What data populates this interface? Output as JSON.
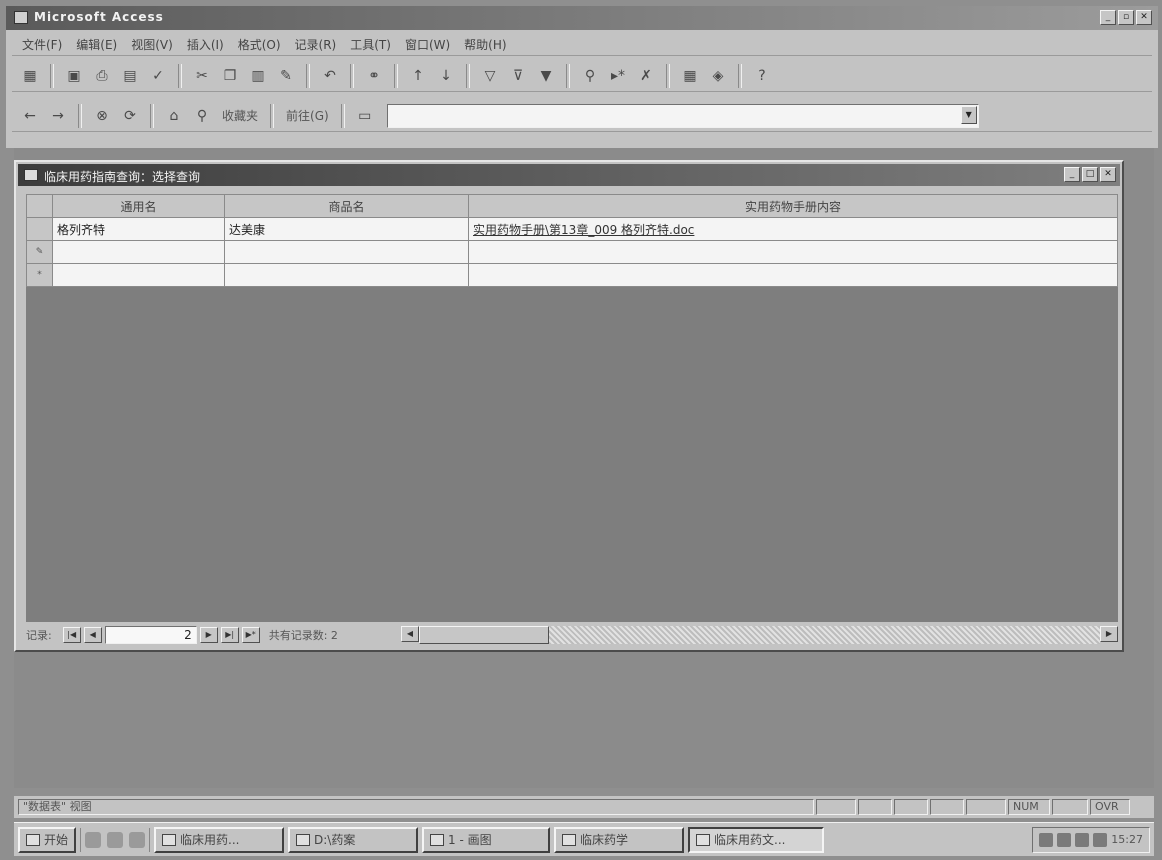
{
  "app": {
    "title": "Microsoft Access",
    "caption_buttons": [
      "minimize",
      "restore",
      "close"
    ]
  },
  "menubar": {
    "items": [
      "文件(F)",
      "编辑(E)",
      "视图(V)",
      "插入(I)",
      "格式(O)",
      "记录(R)",
      "工具(T)",
      "窗口(W)",
      "帮助(H)"
    ]
  },
  "toolbar1": {
    "icons": [
      "view-icon",
      "save-icon",
      "print-icon",
      "print-preview-icon",
      "spelling-icon",
      "cut-icon",
      "copy-icon",
      "paste-icon",
      "format-painter-icon",
      "undo-icon",
      "insert-hyperlink-icon",
      "sort-ascending-icon",
      "sort-descending-icon",
      "filter-by-selection-icon",
      "filter-by-form-icon",
      "apply-filter-icon",
      "find-icon",
      "new-record-icon",
      "delete-record-icon",
      "database-window-icon",
      "new-object-icon",
      "help-icon"
    ]
  },
  "toolbar2": {
    "favorites_label": "收藏夹",
    "go_label": "前往(G)",
    "address_value": ""
  },
  "query_window": {
    "title": "临床用药指南查询：选择查询",
    "columns": [
      "通用名",
      "商品名",
      "实用药物手册内容"
    ],
    "rows": [
      {
        "selector": "",
        "generic": "格列齐特",
        "brand": "达美康",
        "content": "实用药物手册\\第13章_009 格列齐特.doc"
      },
      {
        "selector": "✎",
        "generic": "",
        "brand": "",
        "content": ""
      },
      {
        "selector": "*",
        "generic": "",
        "brand": "",
        "content": ""
      }
    ],
    "nav": {
      "record_label": "记录:",
      "current_record": "2",
      "total_text": "共有记录数: 2"
    }
  },
  "statusbar": {
    "text": "\"数据表\" 视图",
    "indicators": [
      "",
      "",
      "",
      "",
      "",
      "NUM",
      "",
      "OVR"
    ]
  },
  "taskbar": {
    "start_label": "开始",
    "buttons": [
      {
        "label": "临床用药...",
        "active": false
      },
      {
        "label": "D:\\药案",
        "active": false
      },
      {
        "label": "1 - 画图",
        "active": false
      },
      {
        "label": "临床药学",
        "active": false
      },
      {
        "label": "临床用药文...",
        "active": true
      }
    ],
    "clock": "15:27"
  }
}
